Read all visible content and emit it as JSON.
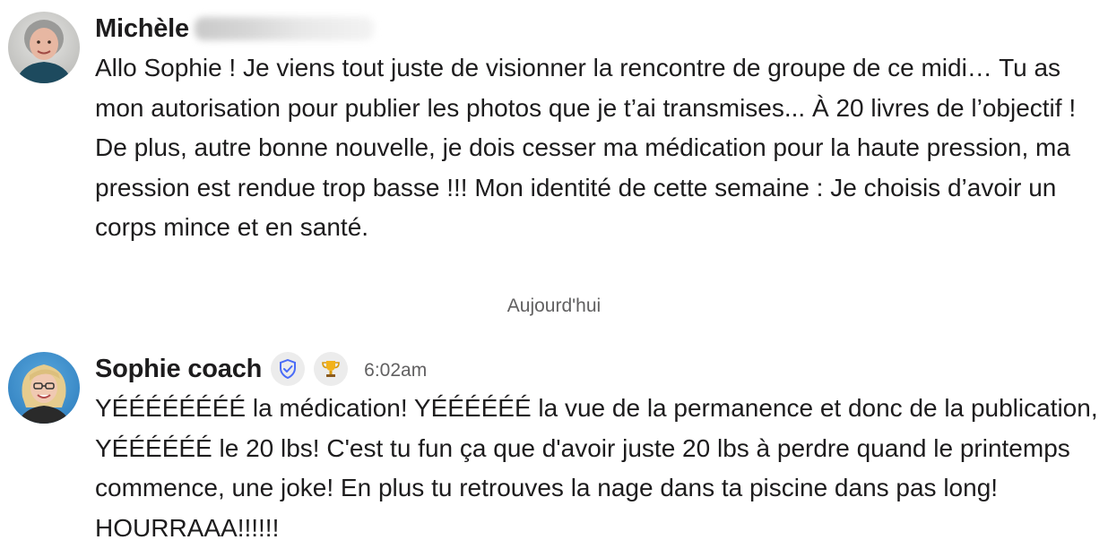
{
  "messages": [
    {
      "author": "Michèle",
      "text": "Allo Sophie ! Je viens tout juste de visionner la rencontre de groupe de ce midi… Tu as mon autorisation pour publier les photos que je t’ai transmises... À 20 livres de l’objectif ! De plus, autre bonne nouvelle, je dois cesser ma médication pour la haute pression, ma pression est rendue trop basse !!! Mon identité de cette semaine : Je choisis d’avoir un corps mince et en santé."
    },
    {
      "author": "Sophie coach",
      "badges": [
        "shield-check-icon",
        "trophy-icon"
      ],
      "time": "6:02am",
      "text": "YÉÉÉÉÉÉÉÉ la médication! YÉÉÉÉÉÉ la vue de la permanence et donc de la publication, YÉÉÉÉÉÉ le 20 lbs! C'est tu fun ça que d'avoir juste 20 lbs à perdre quand le printemps commence, une joke! En plus tu retrouves la nage dans ta piscine dans pas long! HOURRAAA!!!!!!"
    }
  ],
  "divider": "Aujourd'hui",
  "colors": {
    "text": "#1d1c1d",
    "muted": "#616061",
    "badge_bg": "#ececec",
    "shield": "#4a6cf7"
  }
}
